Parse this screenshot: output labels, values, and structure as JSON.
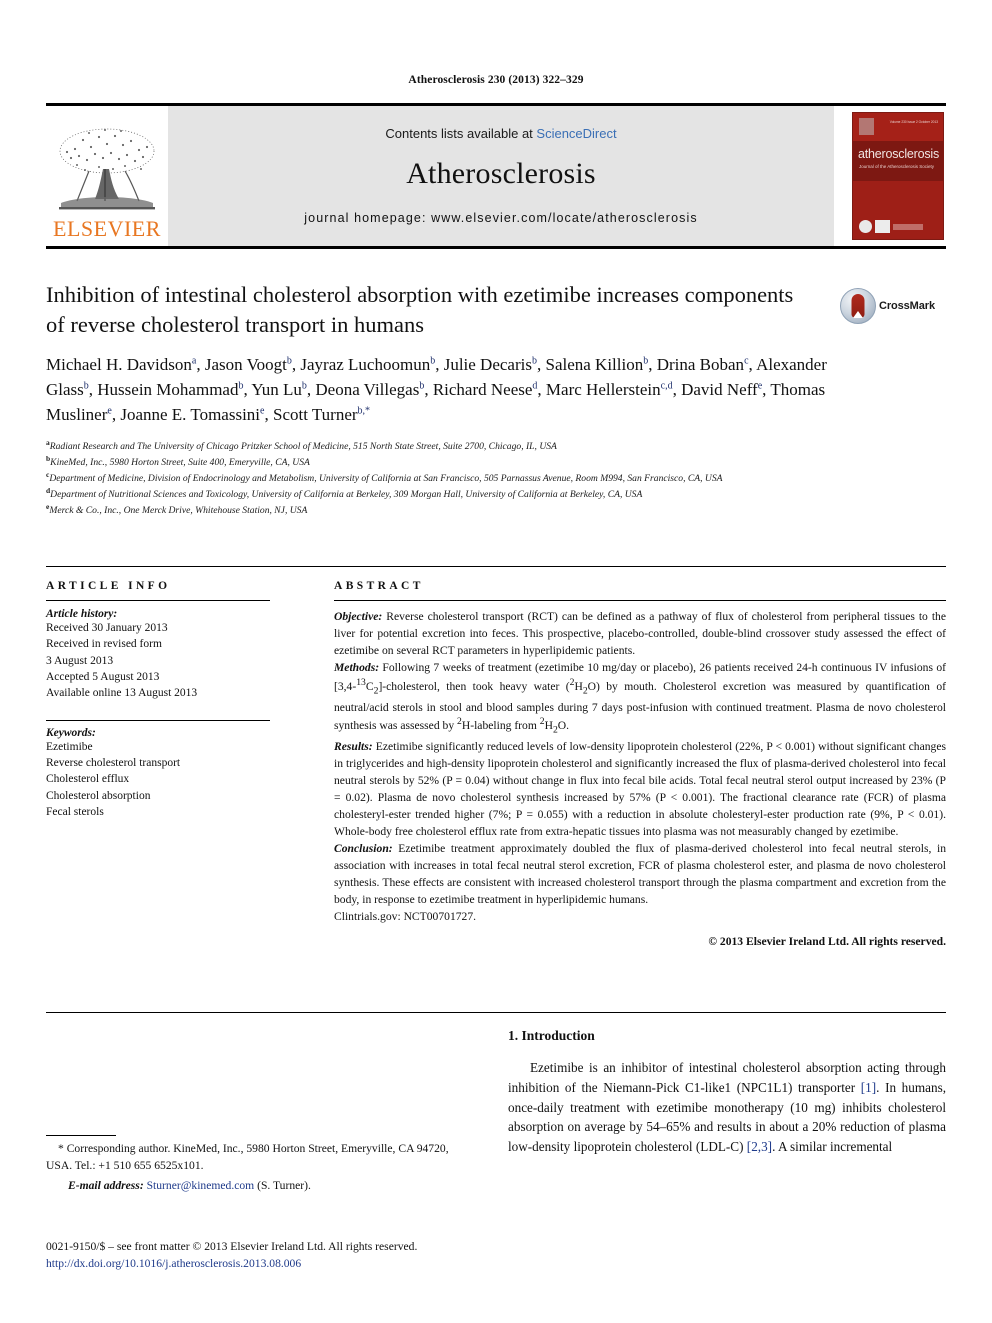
{
  "running_head": "Atherosclerosis 230 (2013) 322–329",
  "masthead": {
    "contents_prefix": "Contents lists available at ",
    "sciencedirect": "ScienceDirect",
    "journal_name": "Atherosclerosis",
    "homepage": "journal homepage: www.elsevier.com/locate/atherosclerosis",
    "publisher_wordmark": "ELSEVIER",
    "cover": {
      "title": "atherosclerosis",
      "subtitle": "Journal of the Atherosclerosis Society",
      "topright": "Volume 230  Issue 2  October 2013"
    }
  },
  "article": {
    "title": "Inhibition of intestinal cholesterol absorption with ezetimibe increases components of reverse cholesterol transport in humans",
    "crossmark_label": "CrossMark",
    "authors_html": "Michael H. Davidson<sup>a</sup>, Jason Voogt<sup>b</sup>, Jayraz Luchoomun<sup>b</sup>, Julie Decaris<sup>b</sup>, Salena Killion<sup>b</sup>, Drina Boban<sup>c</sup>, Alexander Glass<sup>b</sup>, Hussein Mohammad<sup>b</sup>, Yun Lu<sup>b</sup>, Deona Villegas<sup>b</sup>, Richard Neese<sup>d</sup>, Marc Hellerstein<sup>c,d</sup>, David Neff<sup>e</sup>, Thomas Musliner<sup>e</sup>, Joanne E. Tomassini<sup>e</sup>, Scott Turner<sup>b,*</sup>",
    "affiliations": [
      {
        "marker": "a",
        "text": "Radiant Research and The University of Chicago Pritzker School of Medicine, 515 North State Street, Suite 2700, Chicago, IL, USA"
      },
      {
        "marker": "b",
        "text": "KineMed, Inc., 5980 Horton Street, Suite 400, Emeryville, CA, USA"
      },
      {
        "marker": "c",
        "text": "Department of Medicine, Division of Endocrinology and Metabolism, University of California at San Francisco, 505 Parnassus Avenue, Room M994, San Francisco, CA, USA"
      },
      {
        "marker": "d",
        "text": "Department of Nutritional Sciences and Toxicology, University of California at Berkeley, 309 Morgan Hall, University of California at Berkeley, CA, USA"
      },
      {
        "marker": "e",
        "text": "Merck & Co., Inc., One Merck Drive, Whitehouse Station, NJ, USA"
      }
    ]
  },
  "article_info": {
    "heading": "ARTICLE INFO",
    "history_label": "Article history:",
    "history": [
      "Received 30 January 2013",
      "Received in revised form",
      "3 August 2013",
      "Accepted 5 August 2013",
      "Available online 13 August 2013"
    ],
    "keywords_label": "Keywords:",
    "keywords": [
      "Ezetimibe",
      "Reverse cholesterol transport",
      "Cholesterol efflux",
      "Cholesterol absorption",
      "Fecal sterols"
    ]
  },
  "abstract": {
    "heading": "ABSTRACT",
    "objective_label": "Objective:",
    "objective_text": " Reverse cholesterol transport (RCT) can be defined as a pathway of flux of cholesterol from peripheral tissues to the liver for potential excretion into feces. This prospective, placebo-controlled, double-blind crossover study assessed the effect of ezetimibe on several RCT parameters in hyperlipidemic patients.",
    "methods_label": "Methods:",
    "methods_html": " Following 7 weeks of treatment (ezetimibe 10 mg/day or placebo), 26 patients received 24-h continuous IV infusions of [3,4-<sup>13</sup>C<sub>2</sub>]-cholesterol, then took heavy water (<sup>2</sup>H<sub>2</sub>O) by mouth. Cholesterol excretion was measured by quantification of neutral/acid sterols in stool and blood samples during 7 days post-infusion with continued treatment. Plasma de novo cholesterol synthesis was assessed by <sup>2</sup>H-labeling from <sup>2</sup>H<sub>2</sub>O.",
    "results_label": "Results:",
    "results_text": " Ezetimibe significantly reduced levels of low-density lipoprotein cholesterol (22%, P < 0.001) without significant changes in triglycerides and high-density lipoprotein cholesterol and significantly increased the flux of plasma-derived cholesterol into fecal neutral sterols by 52% (P = 0.04) without change in flux into fecal bile acids. Total fecal neutral sterol output increased by 23% (P = 0.02). Plasma de novo cholesterol synthesis increased by 57% (P < 0.001). The fractional clearance rate (FCR) of plasma cholesteryl-ester trended higher (7%; P = 0.055) with a reduction in absolute cholesteryl-ester production rate (9%, P < 0.01). Whole-body free cholesterol efflux rate from extra-hepatic tissues into plasma was not measurably changed by ezetimibe.",
    "conclusion_label": "Conclusion:",
    "conclusion_text": " Ezetimibe treatment approximately doubled the flux of plasma-derived cholesterol into fecal neutral sterols, in association with increases in total fecal neutral sterol excretion, FCR of plasma cholesterol ester, and plasma de novo cholesterol synthesis. These effects are consistent with increased cholesterol transport through the plasma compartment and excretion from the body, in response to ezetimibe treatment in hyperlipidemic humans.",
    "clintrials": "Clintrials.gov: NCT00701727.",
    "copyright": "© 2013 Elsevier Ireland Ltd. All rights reserved."
  },
  "introduction": {
    "heading": "1. Introduction",
    "paragraph_pre1": "Ezetimibe is an inhibitor of intestinal cholesterol absorption acting through inhibition of the Niemann-Pick C1-like1 (NPC1L1) transporter ",
    "ref1": "[1]",
    "paragraph_mid": ". In humans, once-daily treatment with ezetimibe monotherapy (10 mg) inhibits cholesterol absorption on average by 54–65% and results in about a 20% reduction of plasma low-density lipoprotein cholesterol (LDL-C) ",
    "ref2": "[2,3]",
    "paragraph_end": ". A similar incremental"
  },
  "corresponding": {
    "text": "* Corresponding author. KineMed, Inc., 5980 Horton Street, Emeryville, CA 94720, USA. Tel.: +1 510 655 6525x101.",
    "email_label": "E-mail address:",
    "email": "Sturner@kinemed.com",
    "email_suffix": " (S. Turner)."
  },
  "footer": {
    "front_matter": "0021-9150/$ – see front matter © 2013 Elsevier Ireland Ltd. All rights reserved.",
    "doi": "http://dx.doi.org/10.1016/j.atherosclerosis.2013.08.006"
  },
  "colors": {
    "elsevier_orange": "#E87722",
    "link_blue": "#1e3a8a",
    "sciencedirect_blue": "#3a6fb5",
    "cover_red": "#9e1f17",
    "band_gray": "#e4e4e4"
  }
}
